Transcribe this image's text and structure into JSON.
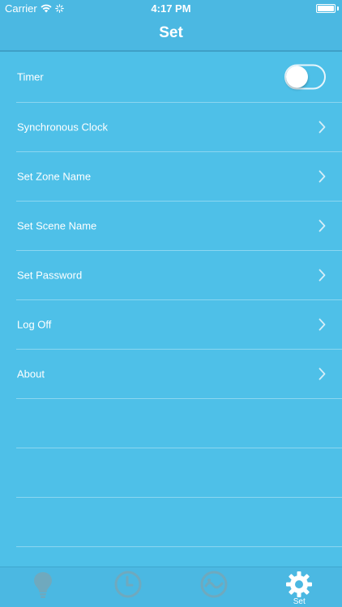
{
  "status_bar": {
    "carrier": "Carrier",
    "time": "4:17 PM",
    "wifi_icon": "wifi-icon",
    "activity_icon": "activity-spinner-icon",
    "battery_icon": "battery-icon"
  },
  "nav": {
    "title": "Set"
  },
  "settings": {
    "timer": {
      "label": "Timer",
      "enabled": false
    },
    "items": [
      {
        "label": "Synchronous Clock"
      },
      {
        "label": "Set Zone Name"
      },
      {
        "label": "Set Scene Name"
      },
      {
        "label": "Set Password"
      },
      {
        "label": "Log Off"
      },
      {
        "label": "About"
      }
    ]
  },
  "tabbar": {
    "tabs": [
      {
        "icon": "lightbulb-icon",
        "label": "",
        "active": false
      },
      {
        "icon": "clock-icon",
        "label": "",
        "active": false
      },
      {
        "icon": "scene-icon",
        "label": "",
        "active": false
      },
      {
        "icon": "gear-icon",
        "label": "Set",
        "active": true
      }
    ]
  },
  "colors": {
    "background": "#4EC0E8",
    "bar": "#4BB8E2",
    "tab_inactive": "#6FA9BE",
    "tab_active": "#FFFFFF"
  }
}
